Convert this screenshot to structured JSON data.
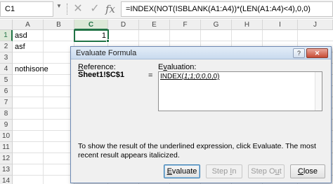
{
  "formula_bar": {
    "name_box": "C1",
    "cancel_glyph": "✕",
    "enter_glyph": "✓",
    "fx_label": "fx",
    "formula": "=INDEX(NOT(ISBLANK(A1:A4))*(LEN(A1:A4)<4),0,0)"
  },
  "sheet": {
    "columns": [
      "A",
      "B",
      "C",
      "D",
      "E",
      "F",
      "G",
      "H",
      "I",
      "J"
    ],
    "selected_column": "C",
    "rows": [
      "1",
      "2",
      "3",
      "4",
      "5",
      "6",
      "7",
      "8",
      "9",
      "10",
      "11",
      "12",
      "13",
      "14"
    ],
    "selected_row": "1",
    "cells": {
      "A1": "asd",
      "A2": "asf",
      "A4": "nothisone",
      "C1": "1"
    }
  },
  "dialog": {
    "title": "Evaluate Formula",
    "help_glyph": "?",
    "close_glyph": "✕",
    "reference_label_u": "R",
    "reference_label_rest": "eference:",
    "reference_value": "Sheet1!$C$1",
    "equals": "=",
    "evaluation_label_u": "v",
    "evaluation_label_pre": "E",
    "evaluation_label_rest": "aluation:",
    "evaluation_underlined": "INDEX(",
    "evaluation_italic": "1;1;0;0",
    "evaluation_tail": ",0,0)",
    "help_text": "To show the result of the underlined expression, click Evaluate.  The most recent result appears italicized.",
    "buttons": {
      "evaluate_u": "E",
      "evaluate_rest": "valuate",
      "step_in_pre": "Step ",
      "step_in_u": "I",
      "step_in_rest": "n",
      "step_out_pre": "Step O",
      "step_out_u": "u",
      "step_out_rest": "t",
      "close_u": "C",
      "close_rest": "lose"
    }
  },
  "colors": {
    "excel_green": "#217346",
    "dialog_bg": "#f0f0f0",
    "title_gradient_top": "#e3edf8"
  }
}
